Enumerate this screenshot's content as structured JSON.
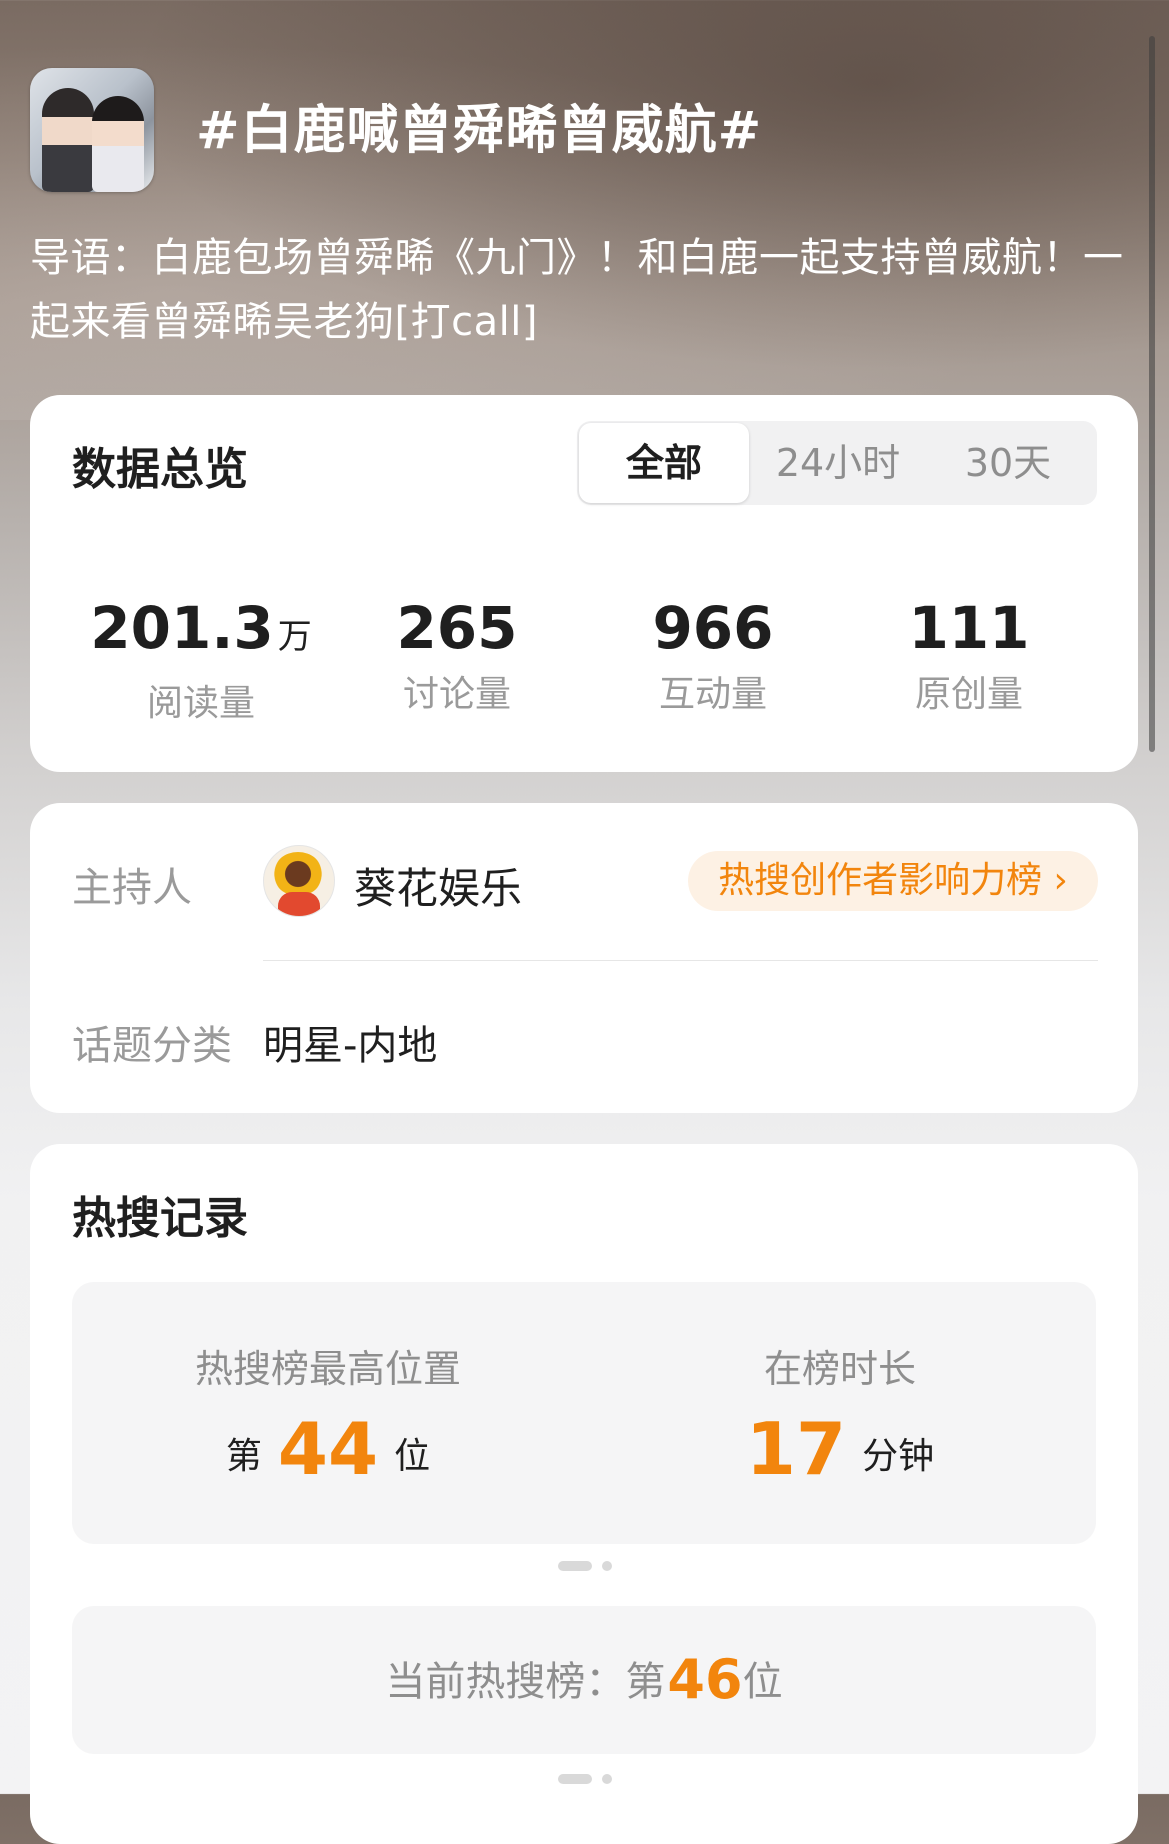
{
  "header": {
    "title": "#白鹿喊曾舜晞曾威航#",
    "intro": "导语：白鹿包场曾舜晞《九门》！和白鹿一起支持曾威航！一起来看曾舜晞吴老狗[打call]"
  },
  "overview": {
    "title": "数据总览",
    "tabs": [
      {
        "label": "全部",
        "active": true
      },
      {
        "label": "24小时",
        "active": false
      },
      {
        "label": "30天",
        "active": false
      }
    ],
    "stats": [
      {
        "value": "201.3",
        "unit": "万",
        "label": "阅读量"
      },
      {
        "value": "265",
        "unit": "",
        "label": "讨论量"
      },
      {
        "value": "966",
        "unit": "",
        "label": "互动量"
      },
      {
        "value": "111",
        "unit": "",
        "label": "原创量"
      }
    ]
  },
  "host": {
    "label": "主持人",
    "name": "葵花娱乐",
    "rank_link": "热搜创作者影响力榜 ›",
    "category_label": "话题分类",
    "category_value": "明星-内地"
  },
  "records": {
    "title": "热搜记录",
    "peak_label": "热搜榜最高位置",
    "peak_prefix": "第",
    "peak_value": "44",
    "peak_suffix": "位",
    "duration_label": "在榜时长",
    "duration_value": "17",
    "duration_unit": "分钟",
    "current_label": "当前热搜榜：第",
    "current_value": "46",
    "current_suffix": "位"
  },
  "colors": {
    "accent": "#f2850d",
    "pill_bg": "#fdf1e4"
  }
}
